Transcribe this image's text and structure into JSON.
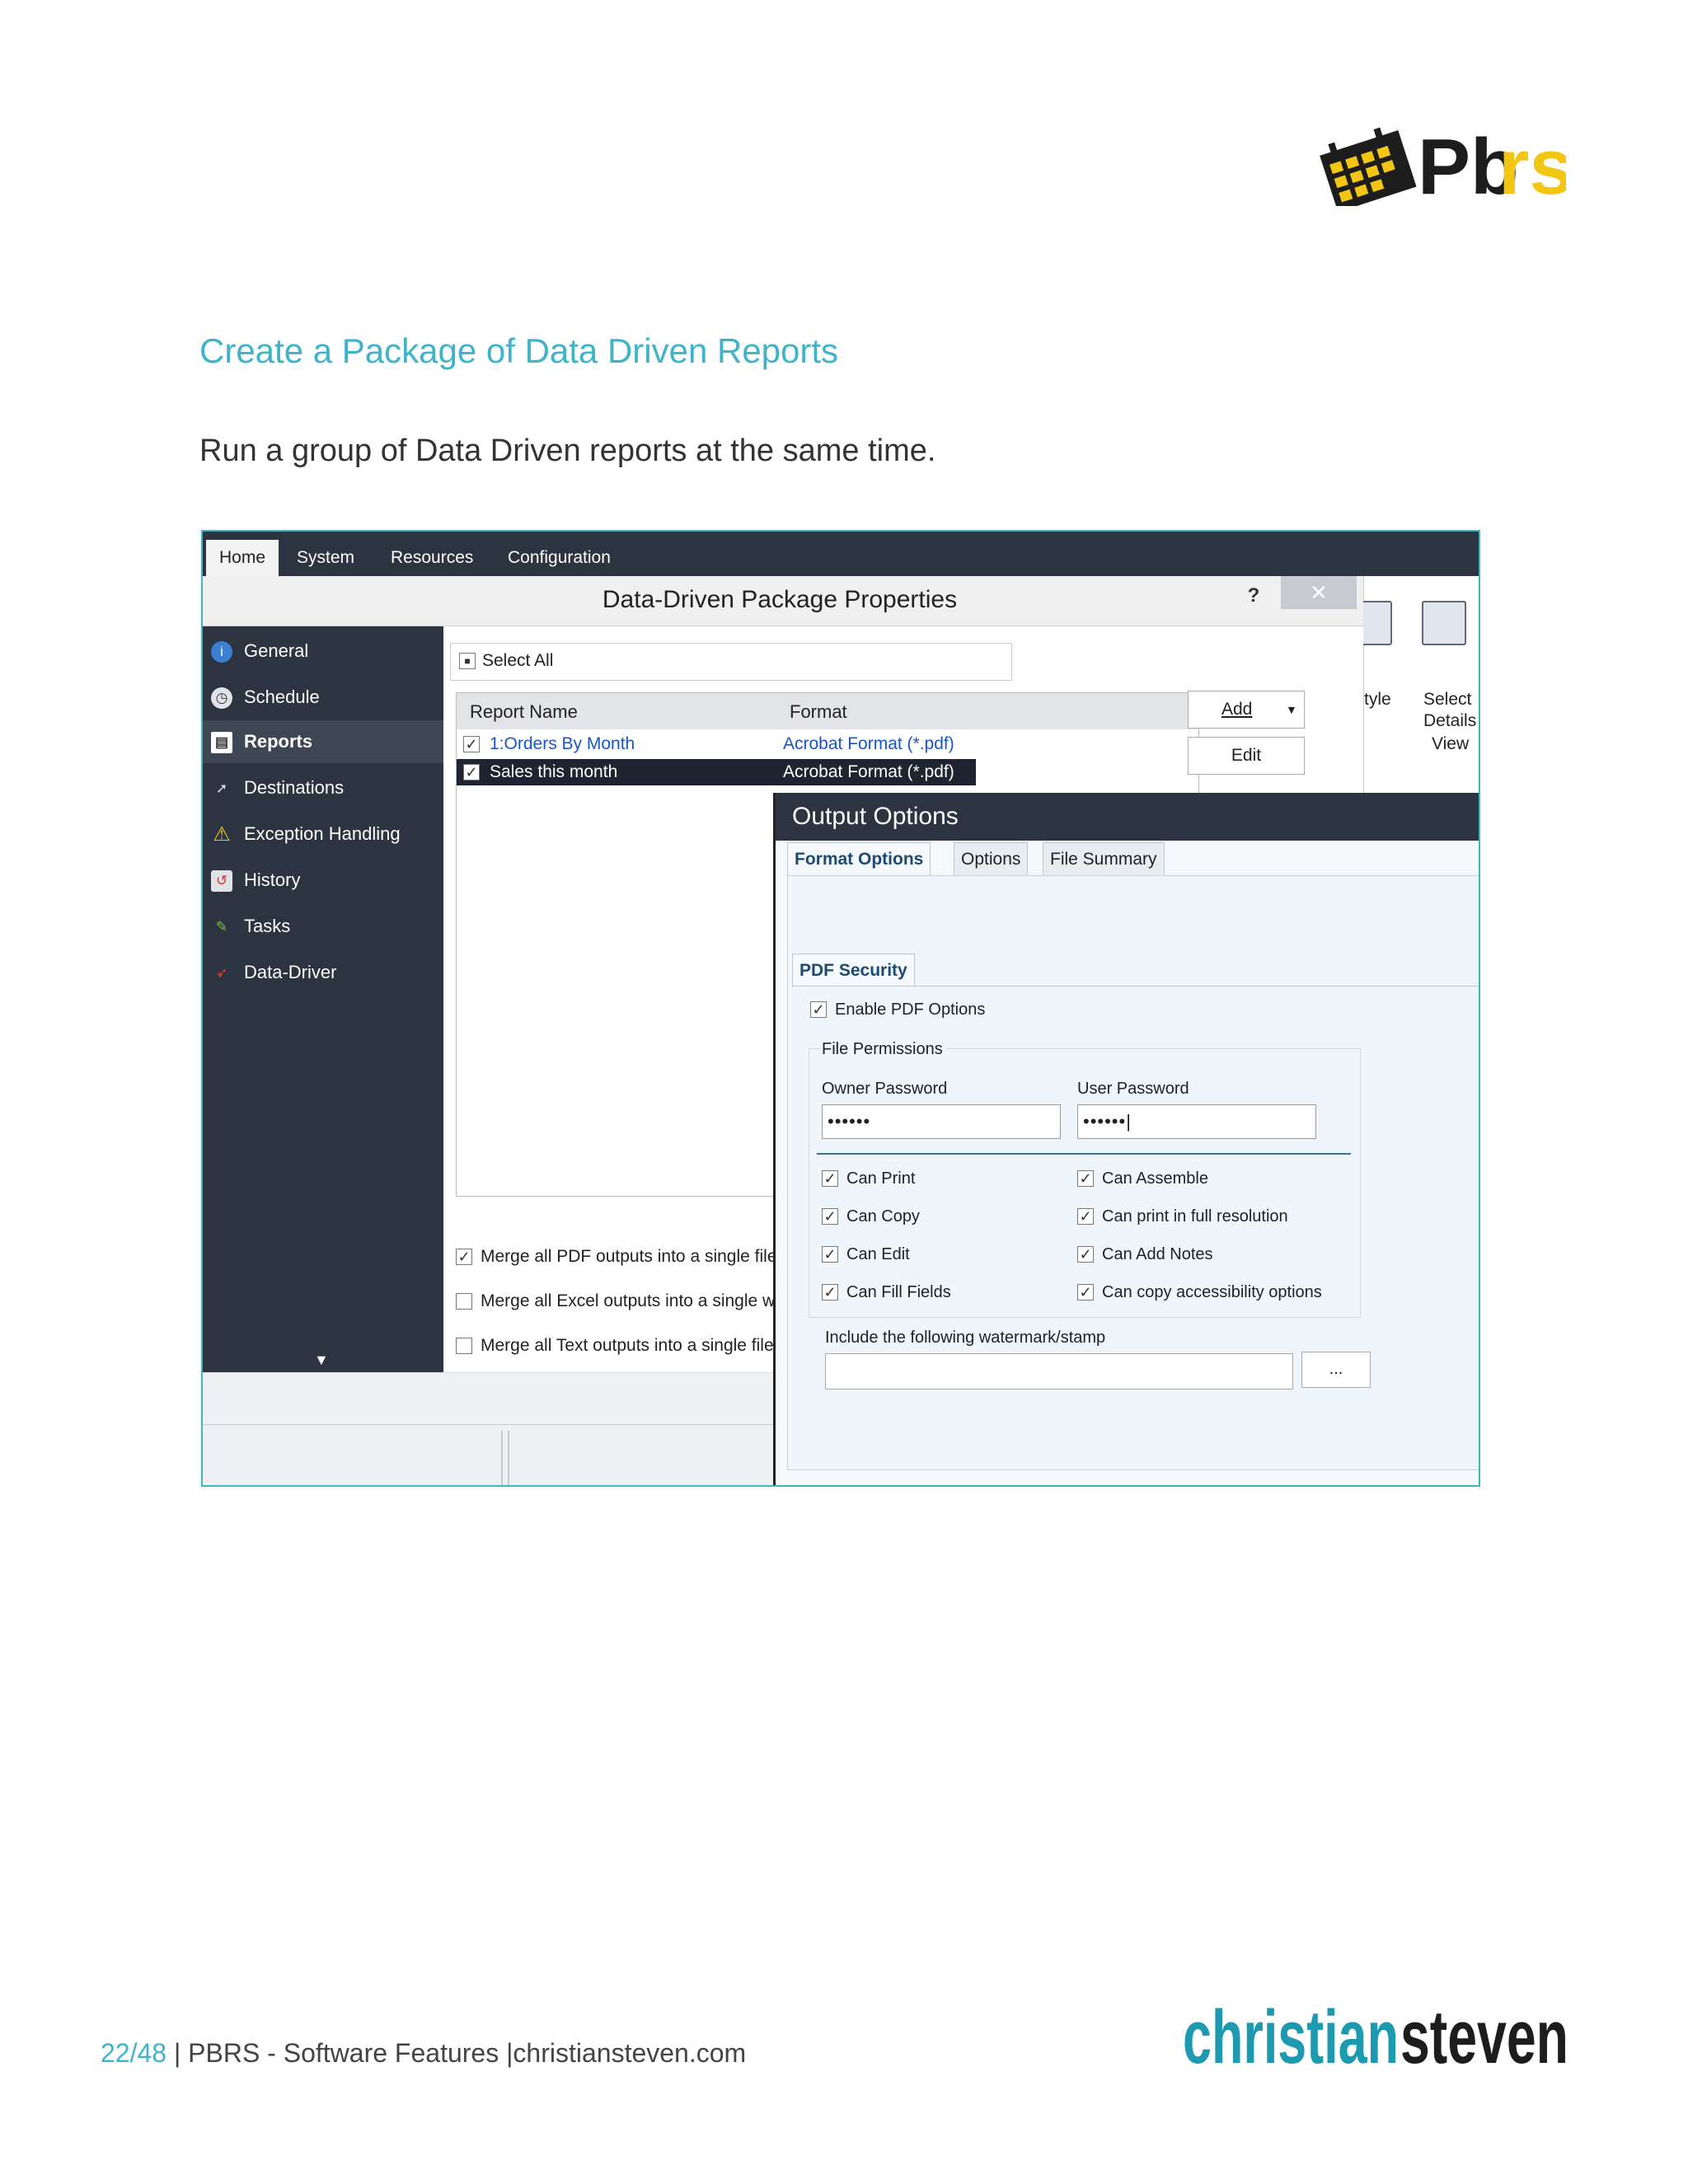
{
  "header": {
    "heading": "Create a Package of Data Driven Reports",
    "subheading": "Run a group of Data Driven reports at the same time."
  },
  "logos": {
    "pbrs": "Pbrs",
    "christiansteven": "christiansteven"
  },
  "screenshot": {
    "ribbon": {
      "tabs": [
        "Home",
        "System",
        "Resources",
        "Configuration"
      ],
      "right_labels": [
        "tyle",
        "Select",
        "Details",
        "View"
      ]
    },
    "dialog": {
      "title": "Data-Driven Package Properties",
      "help": "?",
      "close": "✕",
      "nav": [
        "General",
        "Schedule",
        "Reports",
        "Destinations",
        "Exception Handling",
        "History",
        "Tasks",
        "Data-Driver"
      ],
      "select_all": "Select All",
      "columns": [
        "Report Name",
        "Format"
      ],
      "rows": [
        {
          "name": "1:Orders By Month",
          "format": "Acrobat Format (*.pdf)"
        },
        {
          "name": "Sales this month",
          "format": "Acrobat Format (*.pdf)"
        }
      ],
      "add_button": "Add",
      "edit_button": "Edit",
      "merge_options": [
        "Merge all PDF outputs into a single file",
        "Merge all Excel outputs into a single w",
        "Merge all Text outputs into a single file"
      ]
    },
    "output_options": {
      "title": "Output Options",
      "tabs": [
        "Format Options",
        "Options",
        "File Summary"
      ],
      "section_tab": "PDF Security",
      "enable_pdf": "Enable PDF Options",
      "file_permissions": "File Permissions",
      "owner_password_label": "Owner Password",
      "owner_password_value": "••••••",
      "user_password_label": "User Password",
      "user_password_value": "••••••|",
      "permissions_left": [
        "Can Print",
        "Can Copy",
        "Can Edit",
        "Can Fill Fields"
      ],
      "permissions_right": [
        "Can Assemble",
        "Can print in full resolution",
        "Can Add Notes",
        "Can copy accessibility options"
      ],
      "watermark_label": "Include the following watermark/stamp",
      "ellipsis_button": "..."
    }
  },
  "footer": {
    "page": "22/48",
    "text": " | PBRS - Software Features |christiansteven.com"
  },
  "colors": {
    "accent": "#3fb4c8",
    "dark_panel": "#2b3440",
    "logo_yellow": "#f3c614",
    "logo_teal": "#1e9ab0"
  }
}
